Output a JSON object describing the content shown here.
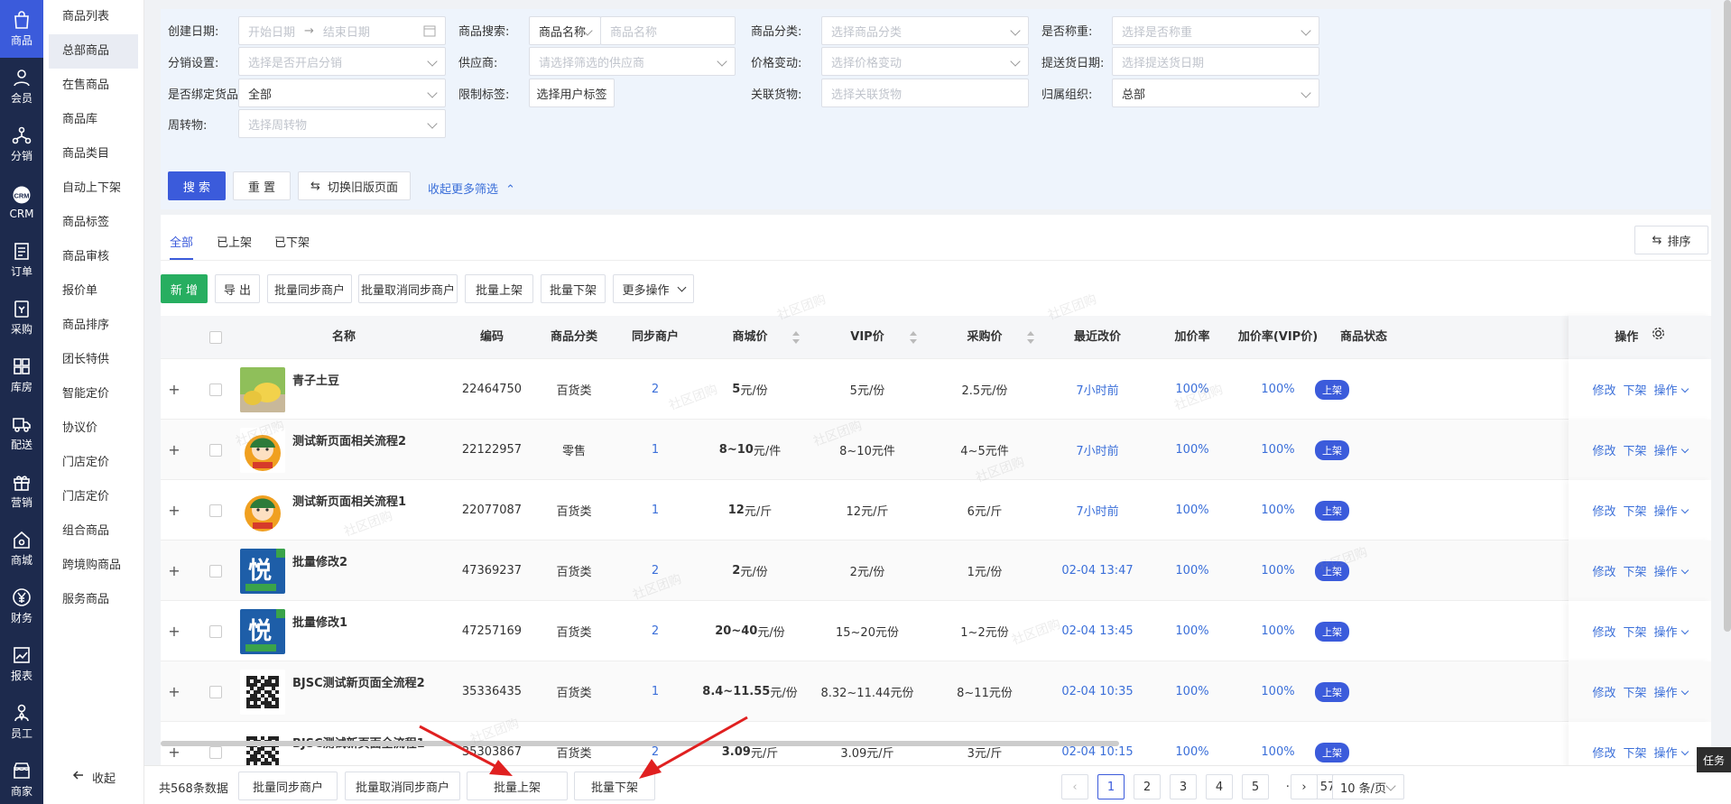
{
  "rail": [
    {
      "label": "商品",
      "icon": "bag-icon",
      "active": true
    },
    {
      "label": "会员",
      "icon": "user-icon"
    },
    {
      "label": "分销",
      "icon": "share-tree-icon"
    },
    {
      "label": "CRM",
      "icon": "crm-icon"
    },
    {
      "label": "订单",
      "icon": "order-icon"
    },
    {
      "label": "采购",
      "icon": "purchase-icon"
    },
    {
      "label": "库房",
      "icon": "warehouse-icon"
    },
    {
      "label": "配送",
      "icon": "truck-icon"
    },
    {
      "label": "营销",
      "icon": "gift-icon"
    },
    {
      "label": "商城",
      "icon": "home-icon"
    },
    {
      "label": "财务",
      "icon": "yen-icon"
    },
    {
      "label": "报表",
      "icon": "chart-icon"
    },
    {
      "label": "员工",
      "icon": "staff-icon"
    },
    {
      "label": "商家",
      "icon": "shop-icon"
    }
  ],
  "submenu": [
    "商品列表",
    "总部商品",
    "在售商品",
    "商品库",
    "商品类目",
    "自动上下架",
    "商品标签",
    "商品审核",
    "报价单",
    "商品排序",
    "团长特供",
    "智能定价",
    "协议价",
    "门店定价",
    "门店定价",
    "组合商品",
    "跨境购商品",
    "服务商品"
  ],
  "submenu_active": 1,
  "collapse_label": "收起",
  "filters": {
    "create_date_label": "创建日期:",
    "start_date_ph": "开始日期",
    "end_date_ph": "结束日期",
    "search_label": "商品搜索:",
    "search_type": "商品名称",
    "search_ph": "商品名称",
    "category_label": "商品分类:",
    "category_ph": "选择商品分类",
    "weigh_label": "是否称重:",
    "weigh_ph": "选择是否称重",
    "dist_label": "分销设置:",
    "dist_ph": "选择是否开启分销",
    "supplier_label": "供应商:",
    "supplier_ph": "请选择筛选的供应商",
    "price_label": "价格变动:",
    "price_ph": "选择价格变动",
    "delivery_label": "提送货日期:",
    "delivery_ph": "选择提送货日期",
    "bind_label": "是否绑定货品:",
    "bind_val": "全部",
    "limit_label": "限制标签:",
    "limit_btn": "选择用户标签",
    "related_label": "关联货物:",
    "related_ph": "选择关联货物",
    "org_label": "归属组织:",
    "org_val": "总部",
    "turnover_label": "周转物:",
    "turnover_ph": "选择周转物",
    "search_btn": "搜 索",
    "reset_btn": "重 置",
    "switch_btn": "切换旧版页面",
    "more_link": "收起更多筛选"
  },
  "tabs": [
    "全部",
    "已上架",
    "已下架"
  ],
  "sort_btn": "排序",
  "actions": [
    "新 增",
    "导 出",
    "批量同步商户",
    "批量取消同步商户",
    "批量上架",
    "批量下架",
    "更多操作"
  ],
  "columns": {
    "name": "名称",
    "code": "编码",
    "cat": "商品分类",
    "sync": "同步商户",
    "mall": "商城价",
    "vip": "VIP价",
    "purchase": "采购价",
    "recent": "最近改价",
    "markup": "加价率",
    "markup_vip": "加价率(VIP价)",
    "status": "商品状态",
    "ops": "操作"
  },
  "rows": [
    {
      "name": "青子土豆",
      "code": "22464750",
      "cat": "百货类",
      "sync": "2",
      "mall_num": "5",
      "mall_unit": " 元/份",
      "vip": "5元/份",
      "purchase": "2.5元/份",
      "recent": "7小时前",
      "markup": "100%",
      "markup_vip": "100%",
      "status": "上架",
      "thumb": "potato"
    },
    {
      "name": "测试新页面相关流程2",
      "code": "22122957",
      "cat": "零售",
      "sync": "1",
      "mall_num": "8~10",
      "mall_unit": " 元/件",
      "vip": "8~10元件",
      "purchase": "4~5元件",
      "recent": "7小时前",
      "markup": "100%",
      "markup_vip": "100%",
      "status": "上架",
      "thumb": "mascot"
    },
    {
      "name": "测试新页面相关流程1",
      "code": "22077087",
      "cat": "百货类",
      "sync": "1",
      "mall_num": "12",
      "mall_unit": " 元/斤",
      "vip": "12元/斤",
      "purchase": "6元/斤",
      "recent": "7小时前",
      "markup": "100%",
      "markup_vip": "100%",
      "status": "上架",
      "thumb": "mascot"
    },
    {
      "name": "批量修改2",
      "code": "47369237",
      "cat": "百货类",
      "sync": "2",
      "mall_num": "2",
      "mall_unit": " 元/份",
      "vip": "2元/份",
      "purchase": "1元/份",
      "recent": "02-04 13:47",
      "markup": "100%",
      "markup_vip": "100%",
      "status": "上架",
      "thumb": "yue"
    },
    {
      "name": "批量修改1",
      "code": "47257169",
      "cat": "百货类",
      "sync": "2",
      "mall_num": "20~40",
      "mall_unit": " 元/份",
      "vip": "15~20元份",
      "purchase": "1~2元份",
      "recent": "02-04 13:45",
      "markup": "100%",
      "markup_vip": "100%",
      "status": "上架",
      "thumb": "yue"
    },
    {
      "name": "BJSC测试新页面全流程2",
      "code": "35336435",
      "cat": "百货类",
      "sync": "1",
      "mall_num": "8.4~11.55",
      "mall_unit": " 元/份",
      "vip": "8.32~11.44元份",
      "purchase": "8~11元份",
      "recent": "02-04 10:35",
      "markup": "100%",
      "markup_vip": "100%",
      "status": "上架",
      "thumb": "qr"
    },
    {
      "name": "BJSC测试新页面全流程1",
      "code": "35303867",
      "cat": "百货类",
      "sync": "2",
      "mall_num": "3.09",
      "mall_unit": " 元/斤",
      "vip": "3.09元/斤",
      "purchase": "3元/斤",
      "recent": "02-04 10:15",
      "markup": "100%",
      "markup_vip": "100%",
      "status": "上架",
      "thumb": "qr"
    }
  ],
  "row_ops": [
    "修改",
    "下架",
    "操作"
  ],
  "bottom": {
    "total": "共568条数据",
    "buttons": [
      "批量同步商户",
      "批量取消同步商户",
      "批量上架",
      "批量下架"
    ]
  },
  "pagination": {
    "pages": [
      "1",
      "2",
      "3",
      "4",
      "5",
      "···",
      "57"
    ],
    "active": "1",
    "per_page": "10 条/页"
  },
  "task_label": "任务",
  "watermark": "社区团购",
  "colors": {
    "primary": "#3b5bdb",
    "green": "#27ae60",
    "rail": "#1d2a4d",
    "link": "#3b6fd9"
  }
}
